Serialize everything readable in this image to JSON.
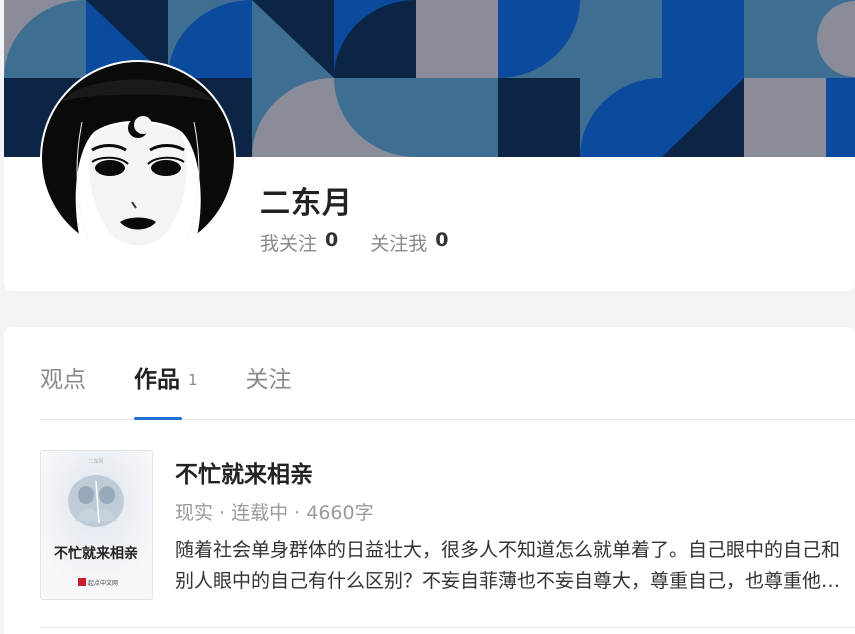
{
  "profile": {
    "name": "二东月",
    "following_label": "我关注",
    "following_count": "0",
    "followers_label": "关注我",
    "followers_count": "0"
  },
  "tabs": [
    {
      "label": "观点",
      "count": "",
      "active": false
    },
    {
      "label": "作品",
      "count": "1",
      "active": true
    },
    {
      "label": "关注",
      "count": "",
      "active": false
    }
  ],
  "works": [
    {
      "title": "不忙就来相亲",
      "meta": "现实 · 连载中 · 4660字",
      "description": "随着社会单身群体的日益壮大，很多人不知道怎么就单着了。自己眼中的自己和别人眼中的自己有什么区别？不妄自菲薄也不妄自尊大，尊重自己，也尊重他人，在相亲中找到属于自己的幸福。",
      "cover_title": "不忙就来相亲",
      "cover_publisher": "起点中文网",
      "cover_author": "二东月"
    }
  ],
  "colors": {
    "accent": "#1e6fd9",
    "cover_navy": "#0d2545",
    "cover_blue": "#0b4a9c",
    "cover_steel": "#3f6e93",
    "cover_gray": "#8a8c99"
  }
}
